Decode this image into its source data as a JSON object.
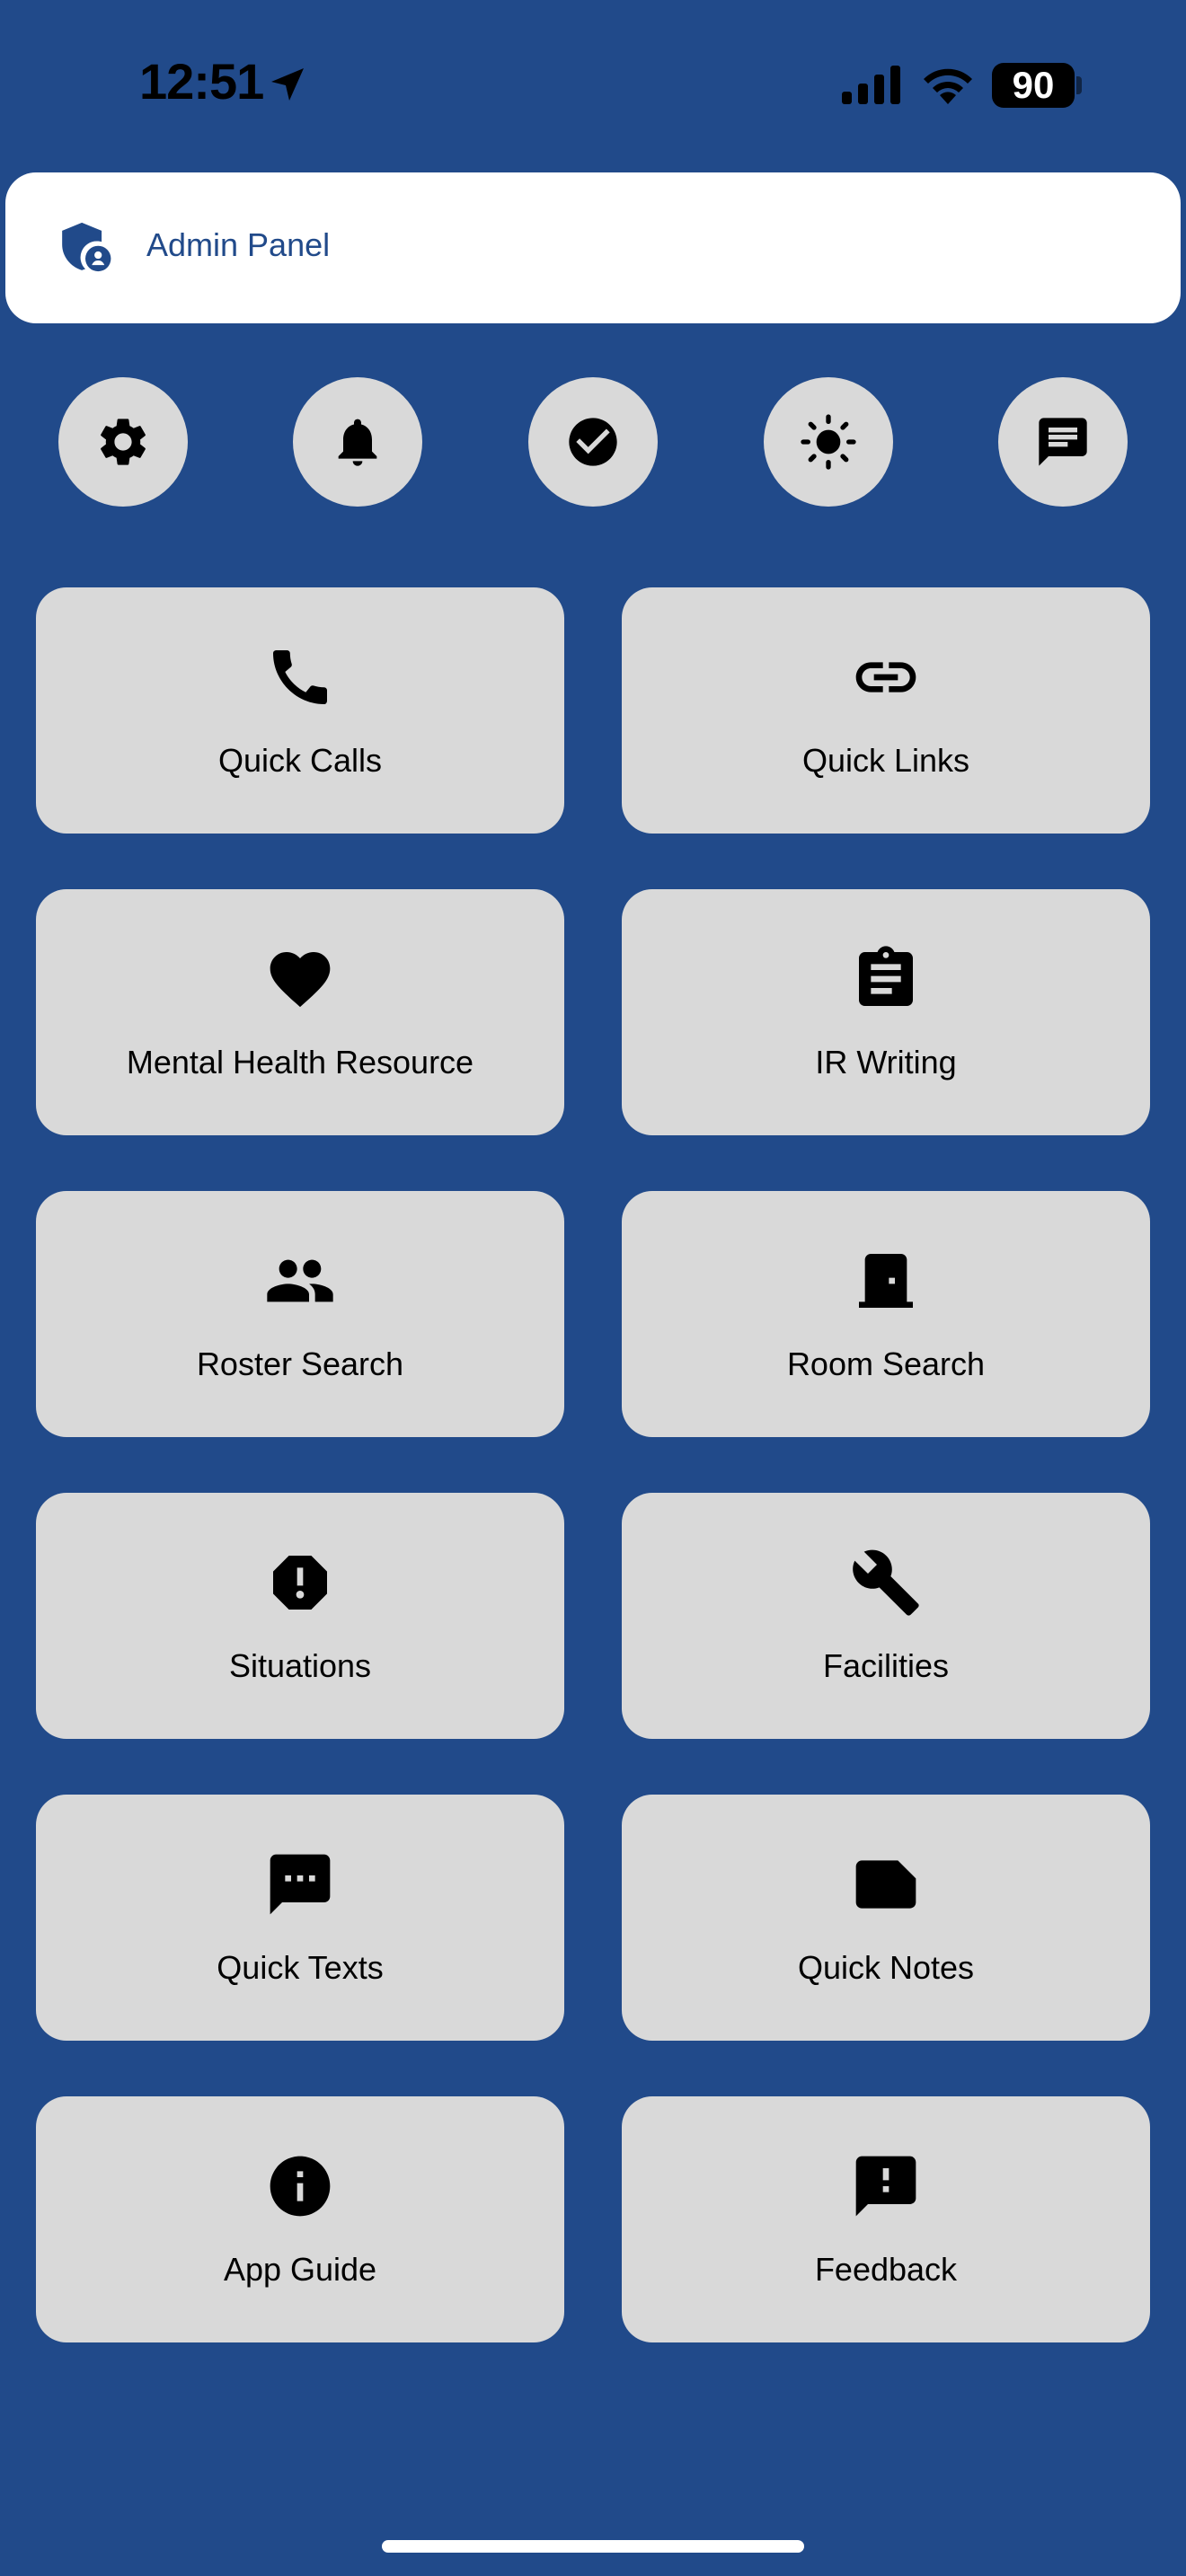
{
  "status_bar": {
    "time": "12:51",
    "battery": "90"
  },
  "admin": {
    "label": "Admin Panel"
  },
  "quick_buttons": [
    {
      "name": "settings",
      "icon": "gear-icon"
    },
    {
      "name": "notifications",
      "icon": "bell-icon"
    },
    {
      "name": "tasks",
      "icon": "check-circle-icon"
    },
    {
      "name": "theme",
      "icon": "sun-icon"
    },
    {
      "name": "messages",
      "icon": "chat-icon"
    }
  ],
  "tiles": [
    {
      "label": "Quick Calls",
      "icon": "phone-icon"
    },
    {
      "label": "Quick Links",
      "icon": "link-icon"
    },
    {
      "label": "Mental Health Resource",
      "icon": "heart-icon"
    },
    {
      "label": "IR Writing",
      "icon": "clipboard-icon"
    },
    {
      "label": "Roster Search",
      "icon": "people-icon"
    },
    {
      "label": "Room Search",
      "icon": "door-icon"
    },
    {
      "label": "Situations",
      "icon": "alert-octagon-icon"
    },
    {
      "label": "Facilities",
      "icon": "wrench-icon"
    },
    {
      "label": "Quick Texts",
      "icon": "sms-icon"
    },
    {
      "label": "Quick Notes",
      "icon": "note-icon"
    },
    {
      "label": "App Guide",
      "icon": "info-icon"
    },
    {
      "label": "Feedback",
      "icon": "feedback-icon"
    }
  ],
  "colors": {
    "background": "#214a8a",
    "tile": "#d9d9d9",
    "accent": "#214a8a"
  }
}
